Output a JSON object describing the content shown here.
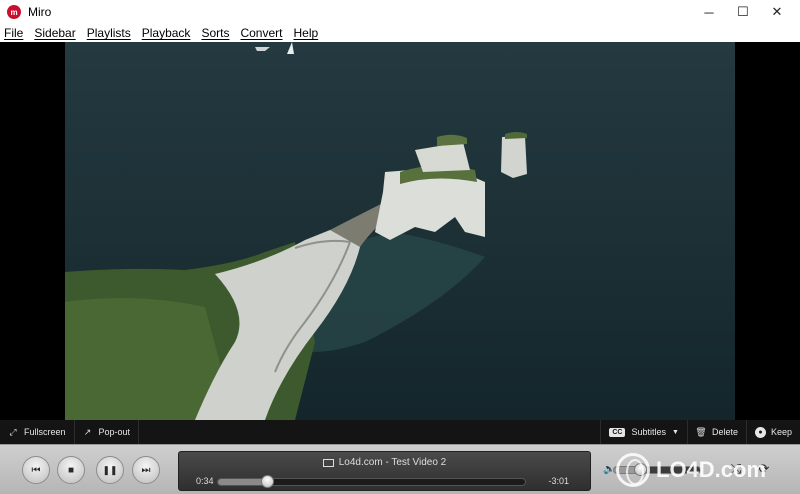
{
  "window": {
    "title": "Miro",
    "icon": "miro-logo-icon",
    "icon_letter": "m",
    "controls": {
      "minimize": "─",
      "maximize": "☐",
      "close": "✕"
    }
  },
  "menubar": {
    "items": [
      "File",
      "Sidebar",
      "Playlists",
      "Playback",
      "Sorts",
      "Convert",
      "Help"
    ]
  },
  "video": {
    "scene": "aerial-coastline-chalk-cliffs",
    "colors": {
      "sea": "#1f3036",
      "cliff": "#d9dbd6",
      "grass": "#3d5a2e"
    }
  },
  "bottom_bar": {
    "fullscreen_label": "Fullscreen",
    "popout_label": "Pop-out",
    "subtitles_badge": "CC",
    "subtitles_label": "Subtitles",
    "subtitles_arrow": "▼",
    "delete_label": "Delete",
    "keep_label": "Keep"
  },
  "transport": {
    "previous": "⏮",
    "stop": "■",
    "pause": "❚❚",
    "next": "⏭"
  },
  "now_playing": {
    "title": "Lo4d.com - Test Video 2",
    "elapsed": "0:34",
    "remaining": "-3:01",
    "progress": 0.16
  },
  "volume": {
    "icon": "speaker-icon",
    "level": 0.3,
    "shuffle_icon": "⤮",
    "repeat_icon": "⟳"
  },
  "watermark": {
    "text": "LO4D.com"
  },
  "colors": {
    "menu_bg": "#ffffff",
    "video_bg": "#000000",
    "bottom_bar_bg": "#141414",
    "controls_bg": "#c4c4c4",
    "brand": "#c8102e"
  }
}
